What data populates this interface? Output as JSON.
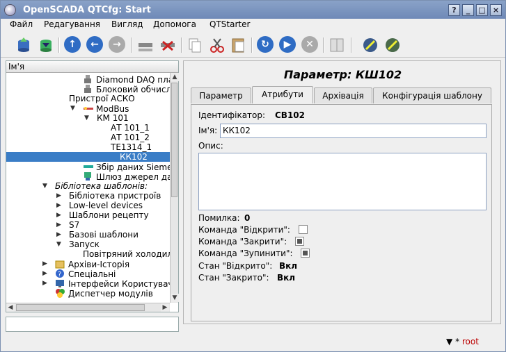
{
  "window": {
    "title": "OpenSCADA QTCfg: Start",
    "buttons": [
      "?",
      "_",
      "□",
      "×"
    ]
  },
  "menu": [
    "Файл",
    "Редагування",
    "Вигляд",
    "Допомога",
    "QTStarter"
  ],
  "tree": {
    "header": "Ім'я",
    "rows": [
      {
        "label": "Diamond DAQ плати",
        "indent": 110,
        "icon": "device-icon"
      },
      {
        "label": "Блоковий обчислюва",
        "indent": 110,
        "icon": "device-icon"
      },
      {
        "label": "Пристрої АСКО",
        "indent": 90,
        "icon": ""
      },
      {
        "label": "ModBus",
        "indent": 110,
        "icon": "modbus-icon",
        "expander": "▼"
      },
      {
        "label": "КМ 101",
        "indent": 130,
        "icon": "",
        "expander": "▼"
      },
      {
        "label": "АТ 101_1",
        "indent": 150,
        "icon": ""
      },
      {
        "label": "АТ 101_2",
        "indent": 150,
        "icon": ""
      },
      {
        "label": "TE1314_1",
        "indent": 150,
        "icon": ""
      },
      {
        "label": "КК102",
        "indent": 150,
        "icon": "",
        "selected": true
      },
      {
        "label": "Збір даних Siemens",
        "indent": 110,
        "icon": "siemens-icon"
      },
      {
        "label": "Шлюз джерел даних",
        "indent": 110,
        "icon": "gateway-icon"
      },
      {
        "label": "Бібліотека шаблонів:",
        "indent": 70,
        "icon": "",
        "expander": "▼",
        "italic": true
      },
      {
        "label": "Бібліотека пристроїв",
        "indent": 90,
        "icon": "",
        "expander": "▶"
      },
      {
        "label": "Low-level devices",
        "indent": 90,
        "icon": "",
        "expander": "▶"
      },
      {
        "label": "Шаблони рецепту",
        "indent": 90,
        "icon": "",
        "expander": "▶"
      },
      {
        "label": "S7",
        "indent": 90,
        "icon": "",
        "expander": "▶"
      },
      {
        "label": "Базові шаблони",
        "indent": 90,
        "icon": "",
        "expander": "▶"
      },
      {
        "label": "Запуск",
        "indent": 90,
        "icon": "",
        "expander": "▼"
      },
      {
        "label": "Повітряний холодил",
        "indent": 110,
        "icon": ""
      },
      {
        "label": "Архіви-Історія",
        "indent": 70,
        "icon": "archive-icon",
        "expander": "▶"
      },
      {
        "label": "Спеціальні",
        "indent": 70,
        "icon": "help-icon",
        "expander": "▶"
      },
      {
        "label": "Інтерфейси Користувача",
        "indent": 70,
        "icon": "monitor-icon",
        "expander": "▶"
      },
      {
        "label": "Диспетчер модулів",
        "indent": 70,
        "icon": "modules-icon"
      }
    ]
  },
  "panel": {
    "title": "Параметр: КШ102",
    "tabs": [
      "Параметр",
      "Атрибути",
      "Архівація",
      "Конфігурація шаблону"
    ],
    "active_tab": 1,
    "id_label": "Ідентифікатор:",
    "id_value": "CB102",
    "name_label": "Ім'я:",
    "name_value": "КК102",
    "desc_label": "Опис:",
    "desc_value": "",
    "error_label": "Помилка:",
    "error_value": "0",
    "cmd_open": "Команда \"Відкрити\":",
    "cmd_close": "Команда \"Закрити\":",
    "cmd_stop": "Команда \"Зупинити\":",
    "cmd_open_checked": false,
    "cmd_close_checked": true,
    "cmd_stop_checked": true,
    "state_open_label": "Стан \"Відкрито\":",
    "state_open_value": "Вкл",
    "state_closed_label": "Стан \"Закрито\":",
    "state_closed_value": "Вкл"
  },
  "status": {
    "marker": "*",
    "user": "root"
  }
}
